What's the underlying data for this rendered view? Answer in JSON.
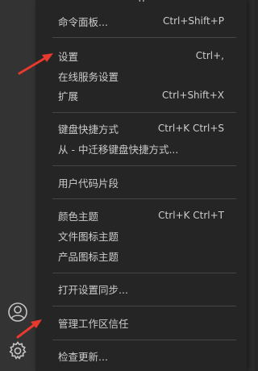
{
  "menu": {
    "top_clipped": "g",
    "groups": [
      [
        {
          "label": "命令面板...",
          "shortcut": "Ctrl+Shift+P"
        }
      ],
      [
        {
          "label": "设置",
          "shortcut": "Ctrl+,"
        },
        {
          "label": "在线服务设置",
          "shortcut": ""
        },
        {
          "label": "扩展",
          "shortcut": "Ctrl+Shift+X"
        }
      ],
      [
        {
          "label": "键盘快捷方式",
          "shortcut": "Ctrl+K Ctrl+S"
        },
        {
          "label": "从 - 中迁移键盘快捷方式...",
          "shortcut": ""
        }
      ],
      [
        {
          "label": "用户代码片段",
          "shortcut": ""
        }
      ],
      [
        {
          "label": "颜色主题",
          "shortcut": "Ctrl+K Ctrl+T"
        },
        {
          "label": "文件图标主题",
          "shortcut": ""
        },
        {
          "label": "产品图标主题",
          "shortcut": ""
        }
      ],
      [
        {
          "label": "打开设置同步...",
          "shortcut": ""
        }
      ],
      [
        {
          "label": "管理工作区信任",
          "shortcut": ""
        }
      ],
      [
        {
          "label": "检查更新...",
          "shortcut": ""
        }
      ]
    ]
  },
  "activity_bar": {
    "icons": [
      "account-icon",
      "gear-icon"
    ]
  },
  "annotations": {
    "arrow_color": "#e8392f"
  },
  "colors": {
    "menu_bg": "#252526",
    "activity_bg": "#333333",
    "separator": "#454545",
    "text": "#cccccc"
  }
}
